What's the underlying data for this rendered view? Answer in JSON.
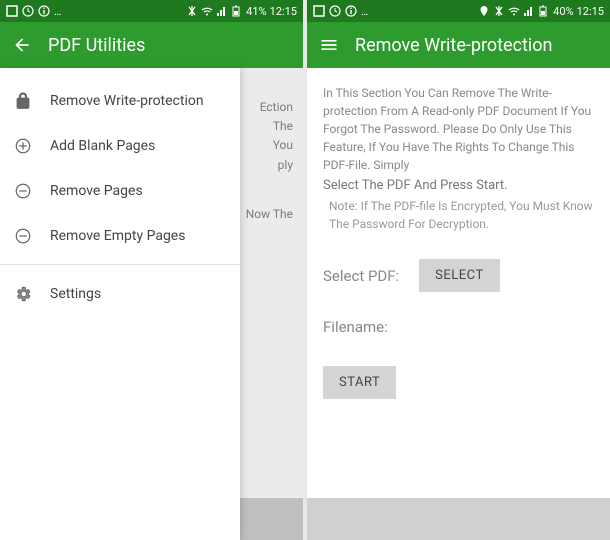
{
  "left": {
    "status": {
      "battery": "41%",
      "time": "12:15"
    },
    "appbar_title": "PDF Utilities",
    "drawer": [
      "Remove Write-protection",
      "Add Blank Pages",
      "Remove Pages",
      "Remove Empty Pages",
      "Settings"
    ],
    "behind": {
      "p1a": "Ection",
      "p1b": "The",
      "p1c": "You",
      "p1d": "ply",
      "p2": "Now The"
    }
  },
  "right": {
    "status": {
      "battery": "40%",
      "time": "12:15"
    },
    "appbar_title": "Remove Write-protection",
    "desc": "In This Section You Can Remove The Write-protection From A Read-only PDF Document If You Forgot The Password. Please Do Only Use This Feature, If You Have The Rights To Change This PDF-File. Simply",
    "desc_bold": "Select The PDF And Press Start.",
    "note": "Note: If The PDF-file Is Encrypted, You Must Know The Password For Decryption.",
    "select_label": "Select PDF:",
    "select_btn": "SELECT",
    "filename_label": "Filename:",
    "start_btn": "START"
  }
}
